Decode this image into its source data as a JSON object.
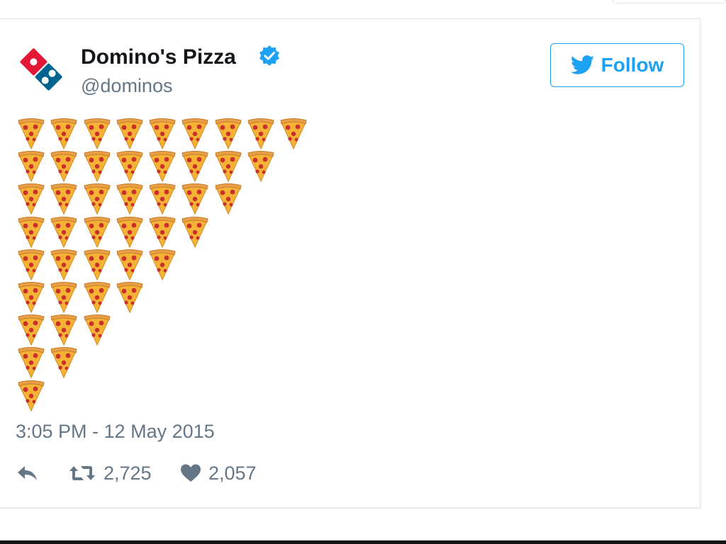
{
  "tweet": {
    "display_name": "Domino's Pizza",
    "handle": "@dominos",
    "follow_label": "Follow",
    "timestamp": "3:05 PM - 12 May 2015",
    "retweets": "2,725",
    "likes": "2,057",
    "emoji_rows": [
      9,
      8,
      7,
      6,
      5,
      4,
      3,
      2,
      1
    ],
    "emoji": "pizza"
  },
  "icons": {
    "brand": "dominos-logo",
    "verified": "verified-badge-icon",
    "follow": "twitter-bird-icon",
    "reply": "reply-icon",
    "retweet": "retweet-icon",
    "like": "heart-icon"
  },
  "colors": {
    "twitter_blue": "#1da1f2",
    "text_primary": "#14171a",
    "text_secondary": "#657786",
    "dominos_red": "#e31837",
    "dominos_blue": "#006491"
  }
}
